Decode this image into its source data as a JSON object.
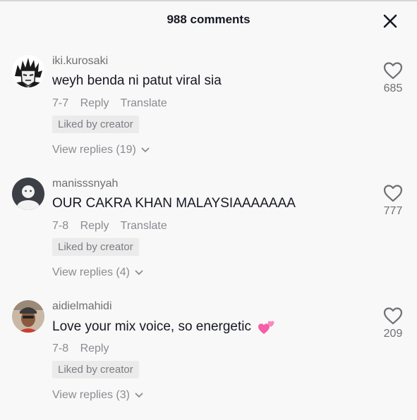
{
  "header": {
    "title": "988 comments",
    "close_icon": "close-icon"
  },
  "comments": [
    {
      "username": "iki.kurosaki",
      "text": "weyh benda ni patut viral sia",
      "date": "7-7",
      "reply_label": "Reply",
      "translate_label": "Translate",
      "badge": "Liked by creator",
      "view_replies": "View replies (19)",
      "likes": "685",
      "avatar_icon": "anime-avatar"
    },
    {
      "username": "manisssnyah",
      "text": "OUR CAKRA KHAN MALAYSIAAAAAAA",
      "date": "7-8",
      "reply_label": "Reply",
      "translate_label": "Translate",
      "badge": "Liked by creator",
      "view_replies": "View replies (4)",
      "likes": "777",
      "avatar_icon": "default-avatar"
    },
    {
      "username": "aidielmahidi",
      "text": "Love your mix voice, so energetic",
      "emoji": "two-hearts-emoji",
      "date": "7-8",
      "reply_label": "Reply",
      "badge": "Liked by creator",
      "view_replies": "View replies (3)",
      "likes": "209",
      "avatar_icon": "photo-avatar"
    }
  ],
  "colors": {
    "heart_pink": "#f55fa7",
    "secondary_text": "#8a8b91",
    "badge_bg": "#ebebeb"
  }
}
